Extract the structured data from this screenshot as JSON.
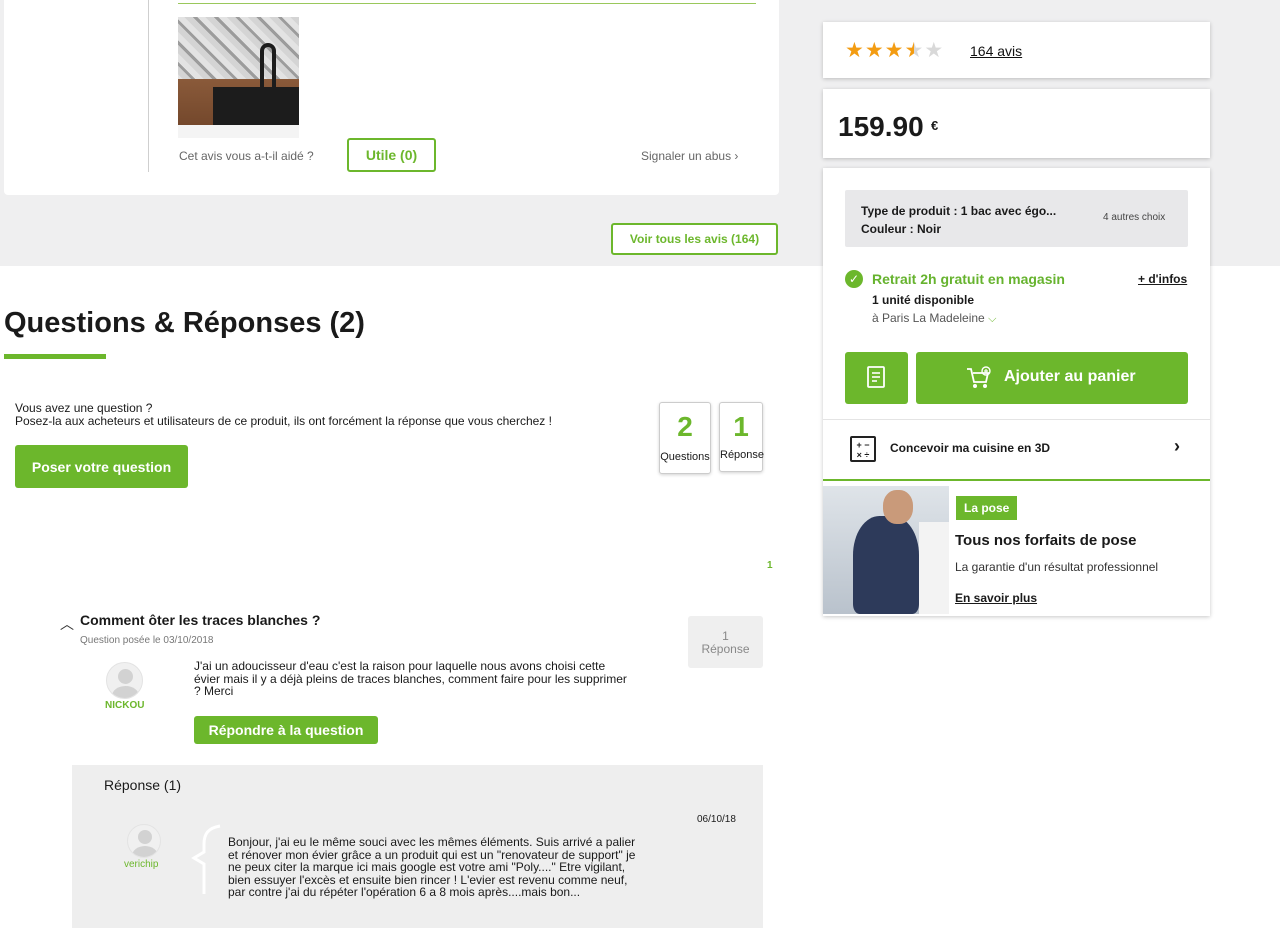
{
  "review": {
    "helpful_question": "Cet avis vous a-t-il aidé ?",
    "useful_label": "Utile (0)",
    "report_label": "Signaler un abus",
    "all_reviews_label": "Voir tous les avis (164)"
  },
  "qa": {
    "title": "Questions & Réponses (2)",
    "ask_line1": "Vous avez une question ?",
    "ask_line2": "Posez-la aux acheteurs et utilisateurs de ce produit, ils ont forcément la réponse que vous cherchez !",
    "ask_button": "Poser votre question",
    "questions_count": "2",
    "questions_label": "Questions",
    "answers_count": "1",
    "answers_label": "Réponse",
    "page_number": "1",
    "question": {
      "title": "Comment ôter les traces blanches ?",
      "date": "Question posée le 03/10/2018",
      "badge_count": "1",
      "badge_label": "Réponse",
      "author": "NICKOU",
      "body": "J'ai un adoucisseur d'eau c'est la raison pour laquelle nous avons choisi cette évier mais il y a déjà pleins de traces blanches, comment faire pour les supprimer ? Merci",
      "reply_button": "Répondre à la question"
    },
    "answers_title": "Réponse (1)",
    "answer": {
      "date": "06/10/18",
      "author": "verichip",
      "body": "Bonjour, j'ai eu le même souci avec les mêmes éléments. Suis arrivé a palier et rénover mon évier grâce a un produit qui est un \"renovateur de support\" je ne peux citer la marque ici mais google est votre ami \"Poly....\" Etre vigilant, bien essuyer l'excès et ensuite bien rincer ! L'evier est revenu comme neuf, par contre j'ai du répéter l'opération 6 a 8 mois après....mais bon..."
    }
  },
  "sidebar": {
    "rating": 3.5,
    "rating_max": 5,
    "reviews_link": "164 avis",
    "price": "159.90",
    "currency": "€",
    "variant_type": "Type de produit : 1 bac avec égo...",
    "variant_color": "Couleur : Noir",
    "variant_choices": "4 autres choix",
    "pickup_title": "Retrait 2h gratuit en magasin",
    "more_info": "+ d'infos",
    "stock": "1 unité disponible",
    "store": "à Paris La Madeleine",
    "add_to_cart": "Ajouter au panier",
    "kitchen_3d": "Concevoir ma cuisine en 3D",
    "pose_tag": "La pose",
    "pose_title": "Tous nos forfaits de pose",
    "pose_subtitle": "La garantie d'un résultat professionnel",
    "pose_link": "En savoir plus"
  },
  "colors": {
    "accent": "#6cb72c",
    "star": "#f39c12",
    "background_grey": "#efeff0"
  }
}
